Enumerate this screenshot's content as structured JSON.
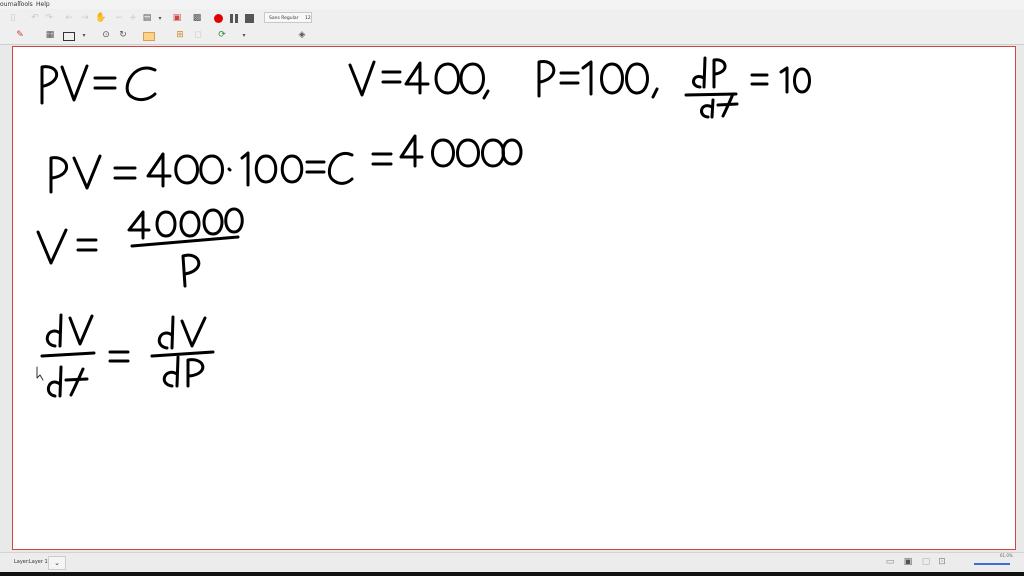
{
  "menu": {
    "item_1": "ournal",
    "item_2": "Tools",
    "item_3": "Help"
  },
  "toolbar": {
    "font_name": "Sans Regular",
    "font_size": "12",
    "pen_colors": [
      "#000000",
      "#008000",
      "#00c0ff",
      "#00c000",
      "#3333cc",
      "#ff8000",
      "#ff00ff",
      "#ff4040",
      "#ff9f3f",
      "#ffff00",
      "#ffffff"
    ],
    "accent_record": "#e00000"
  },
  "status": {
    "layer_label": "Layer:",
    "layer_value": "Layer 1",
    "zoom_text": "61.0%"
  }
}
